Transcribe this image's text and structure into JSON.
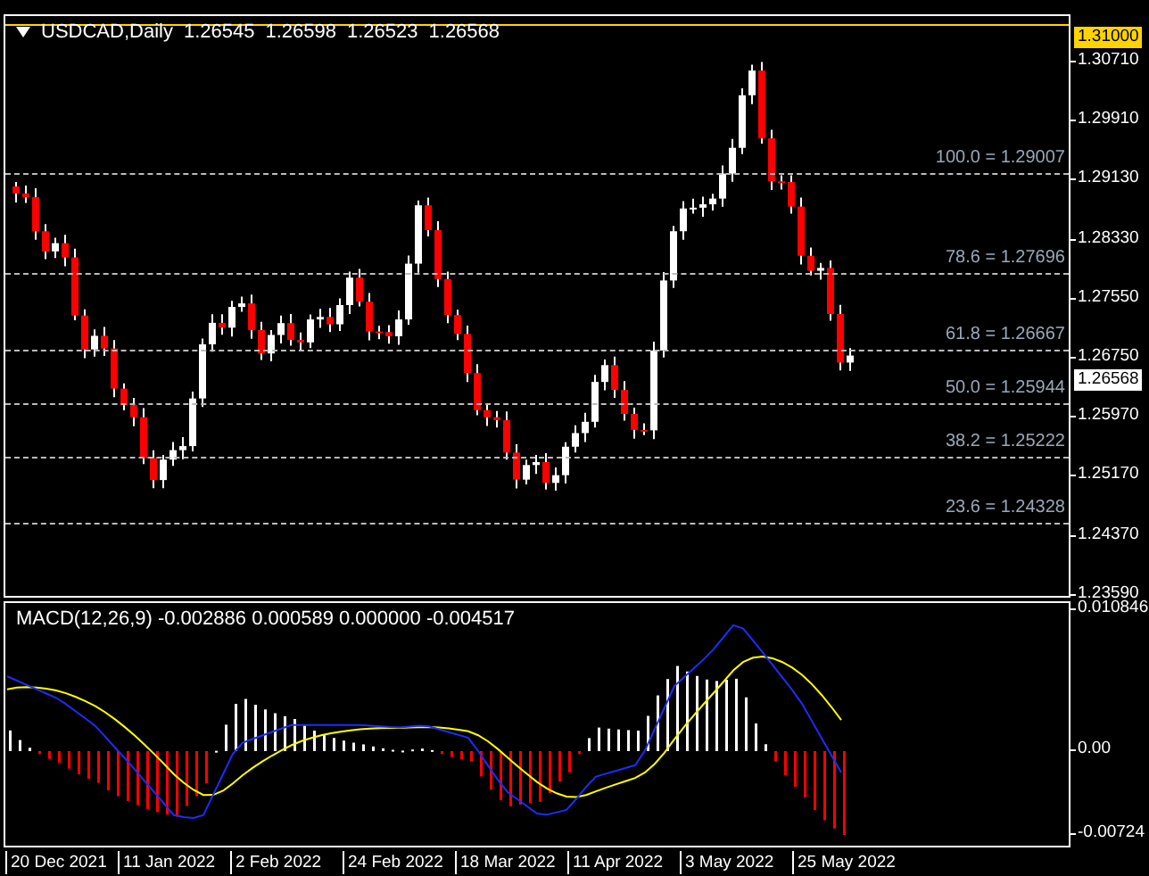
{
  "chart": {
    "symbol": "USDCAD,Daily",
    "ohlc": [
      "1.26545",
      "1.26598",
      "1.26523",
      "1.26568"
    ],
    "price_scale": [
      {
        "label": "1.31000",
        "kind": "marker"
      },
      {
        "label": "1.30710",
        "kind": "tick"
      },
      {
        "label": "1.29910",
        "kind": "tick"
      },
      {
        "label": "1.29130",
        "kind": "tick"
      },
      {
        "label": "1.28330",
        "kind": "tick"
      },
      {
        "label": "1.27550",
        "kind": "tick"
      },
      {
        "label": "1.26750",
        "kind": "tick"
      },
      {
        "label": "1.26568",
        "kind": "current"
      },
      {
        "label": "1.25970",
        "kind": "tick"
      },
      {
        "label": "1.25170",
        "kind": "tick"
      },
      {
        "label": "1.24370",
        "kind": "tick"
      },
      {
        "label": "1.23590",
        "kind": "tick"
      }
    ],
    "fib_levels": [
      {
        "label": "100.0 = 1.29007"
      },
      {
        "label": "78.6 = 1.27696"
      },
      {
        "label": "61.8 = 1.26667"
      },
      {
        "label": "50.0 = 1.25944"
      },
      {
        "label": "38.2 = 1.25222"
      },
      {
        "label": "23.6 = 1.24328"
      }
    ]
  },
  "macd": {
    "title": "MACD(12,26,9) -0.002886 0.000589 0.000000 -0.004517",
    "scale": [
      "0.010846",
      "0.00",
      "-0.00724"
    ]
  },
  "time_axis": [
    "20 Dec 2021",
    "11 Jan 2022",
    "2 Feb 2022",
    "24 Feb 2022",
    "18 Mar 2022",
    "11 Apr 2022",
    "3 May 2022",
    "25 May 2022"
  ]
}
